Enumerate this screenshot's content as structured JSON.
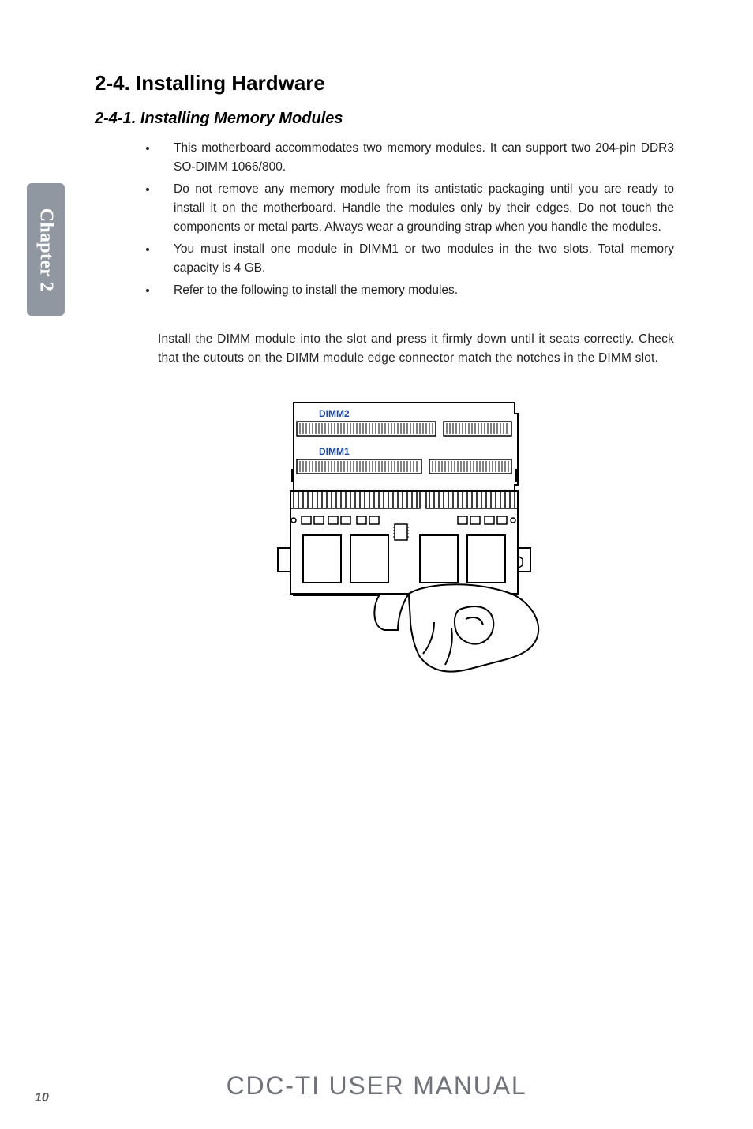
{
  "side_tab": "Chapter 2",
  "section": {
    "number": "2-4.",
    "title": "Installing Hardware"
  },
  "subsection": {
    "number": "2-4-1.",
    "title": "Installing Memory Modules"
  },
  "bullets": [
    "This motherboard accommodates two memory modules. It can support two 204-pin DDR3 SO-DIMM 1066/800.",
    "Do not remove any memory module from its antistatic packaging until you are ready to install it on the motherboard. Handle the modules only by their edges. Do not touch the components or metal parts. Always wear a grounding strap when you handle the modules.",
    "You must install one module in DIMM1 or two modules in the two slots. Total memory capacity is 4 GB.",
    "Refer to the following to install the memory modules."
  ],
  "install_paragraph": "Install the DIMM module into the slot and press it firmly down until it seats correctly. Check that the cutouts on the DIMM module edge connector match the notches in the DIMM slot.",
  "figure": {
    "slot_labels": {
      "top": "DIMM2",
      "bottom": "DIMM1"
    }
  },
  "footer": "CDC-TI USER MANUAL",
  "page_number": "10"
}
